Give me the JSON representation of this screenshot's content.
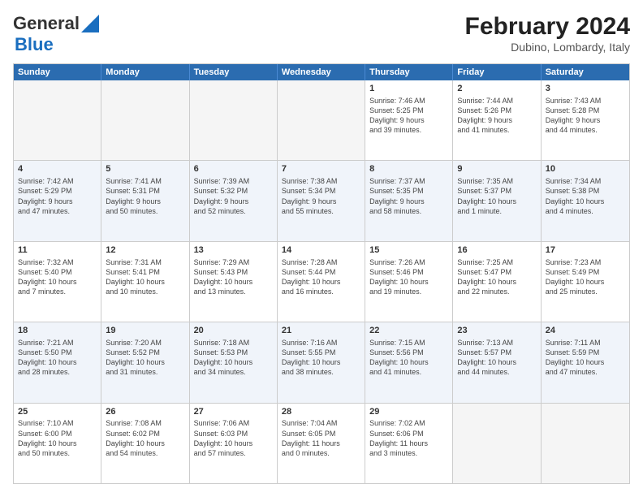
{
  "header": {
    "logo_line1": "General",
    "logo_line2": "Blue",
    "main_title": "February 2024",
    "subtitle": "Dubino, Lombardy, Italy"
  },
  "weekdays": [
    "Sunday",
    "Monday",
    "Tuesday",
    "Wednesday",
    "Thursday",
    "Friday",
    "Saturday"
  ],
  "rows": [
    [
      {
        "day": "",
        "info": ""
      },
      {
        "day": "",
        "info": ""
      },
      {
        "day": "",
        "info": ""
      },
      {
        "day": "",
        "info": ""
      },
      {
        "day": "1",
        "info": "Sunrise: 7:46 AM\nSunset: 5:25 PM\nDaylight: 9 hours\nand 39 minutes."
      },
      {
        "day": "2",
        "info": "Sunrise: 7:44 AM\nSunset: 5:26 PM\nDaylight: 9 hours\nand 41 minutes."
      },
      {
        "day": "3",
        "info": "Sunrise: 7:43 AM\nSunset: 5:28 PM\nDaylight: 9 hours\nand 44 minutes."
      }
    ],
    [
      {
        "day": "4",
        "info": "Sunrise: 7:42 AM\nSunset: 5:29 PM\nDaylight: 9 hours\nand 47 minutes."
      },
      {
        "day": "5",
        "info": "Sunrise: 7:41 AM\nSunset: 5:31 PM\nDaylight: 9 hours\nand 50 minutes."
      },
      {
        "day": "6",
        "info": "Sunrise: 7:39 AM\nSunset: 5:32 PM\nDaylight: 9 hours\nand 52 minutes."
      },
      {
        "day": "7",
        "info": "Sunrise: 7:38 AM\nSunset: 5:34 PM\nDaylight: 9 hours\nand 55 minutes."
      },
      {
        "day": "8",
        "info": "Sunrise: 7:37 AM\nSunset: 5:35 PM\nDaylight: 9 hours\nand 58 minutes."
      },
      {
        "day": "9",
        "info": "Sunrise: 7:35 AM\nSunset: 5:37 PM\nDaylight: 10 hours\nand 1 minute."
      },
      {
        "day": "10",
        "info": "Sunrise: 7:34 AM\nSunset: 5:38 PM\nDaylight: 10 hours\nand 4 minutes."
      }
    ],
    [
      {
        "day": "11",
        "info": "Sunrise: 7:32 AM\nSunset: 5:40 PM\nDaylight: 10 hours\nand 7 minutes."
      },
      {
        "day": "12",
        "info": "Sunrise: 7:31 AM\nSunset: 5:41 PM\nDaylight: 10 hours\nand 10 minutes."
      },
      {
        "day": "13",
        "info": "Sunrise: 7:29 AM\nSunset: 5:43 PM\nDaylight: 10 hours\nand 13 minutes."
      },
      {
        "day": "14",
        "info": "Sunrise: 7:28 AM\nSunset: 5:44 PM\nDaylight: 10 hours\nand 16 minutes."
      },
      {
        "day": "15",
        "info": "Sunrise: 7:26 AM\nSunset: 5:46 PM\nDaylight: 10 hours\nand 19 minutes."
      },
      {
        "day": "16",
        "info": "Sunrise: 7:25 AM\nSunset: 5:47 PM\nDaylight: 10 hours\nand 22 minutes."
      },
      {
        "day": "17",
        "info": "Sunrise: 7:23 AM\nSunset: 5:49 PM\nDaylight: 10 hours\nand 25 minutes."
      }
    ],
    [
      {
        "day": "18",
        "info": "Sunrise: 7:21 AM\nSunset: 5:50 PM\nDaylight: 10 hours\nand 28 minutes."
      },
      {
        "day": "19",
        "info": "Sunrise: 7:20 AM\nSunset: 5:52 PM\nDaylight: 10 hours\nand 31 minutes."
      },
      {
        "day": "20",
        "info": "Sunrise: 7:18 AM\nSunset: 5:53 PM\nDaylight: 10 hours\nand 34 minutes."
      },
      {
        "day": "21",
        "info": "Sunrise: 7:16 AM\nSunset: 5:55 PM\nDaylight: 10 hours\nand 38 minutes."
      },
      {
        "day": "22",
        "info": "Sunrise: 7:15 AM\nSunset: 5:56 PM\nDaylight: 10 hours\nand 41 minutes."
      },
      {
        "day": "23",
        "info": "Sunrise: 7:13 AM\nSunset: 5:57 PM\nDaylight: 10 hours\nand 44 minutes."
      },
      {
        "day": "24",
        "info": "Sunrise: 7:11 AM\nSunset: 5:59 PM\nDaylight: 10 hours\nand 47 minutes."
      }
    ],
    [
      {
        "day": "25",
        "info": "Sunrise: 7:10 AM\nSunset: 6:00 PM\nDaylight: 10 hours\nand 50 minutes."
      },
      {
        "day": "26",
        "info": "Sunrise: 7:08 AM\nSunset: 6:02 PM\nDaylight: 10 hours\nand 54 minutes."
      },
      {
        "day": "27",
        "info": "Sunrise: 7:06 AM\nSunset: 6:03 PM\nDaylight: 10 hours\nand 57 minutes."
      },
      {
        "day": "28",
        "info": "Sunrise: 7:04 AM\nSunset: 6:05 PM\nDaylight: 11 hours\nand 0 minutes."
      },
      {
        "day": "29",
        "info": "Sunrise: 7:02 AM\nSunset: 6:06 PM\nDaylight: 11 hours\nand 3 minutes."
      },
      {
        "day": "",
        "info": ""
      },
      {
        "day": "",
        "info": ""
      }
    ]
  ]
}
